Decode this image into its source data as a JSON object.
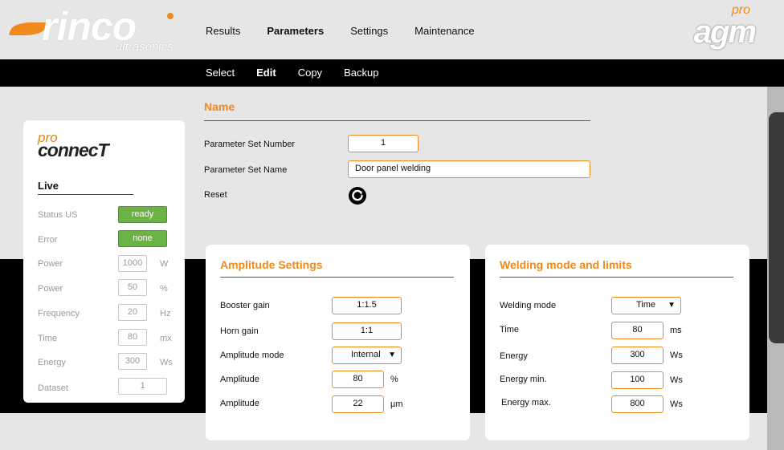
{
  "header": {
    "brand_left": "rinco",
    "brand_left_sub": "ultrasonics",
    "brand_right": "agm",
    "brand_right_pro": "pro",
    "nav": [
      {
        "label": "Results"
      },
      {
        "label": "Parameters"
      },
      {
        "label": "Settings"
      },
      {
        "label": "Maintenance"
      }
    ],
    "active_nav": "Parameters"
  },
  "subnav": {
    "items": [
      {
        "label": "Select"
      },
      {
        "label": "Edit"
      },
      {
        "label": "Copy"
      },
      {
        "label": "Backup"
      }
    ],
    "active": "Edit"
  },
  "name_section": {
    "title": "Name",
    "param_set_number_label": "Parameter Set Number",
    "param_set_number_value": "1",
    "param_set_name_label": "Parameter Set Name",
    "param_set_name_value": "Door panel welding",
    "reset_label": "Reset",
    "reset_icon": "reset-icon"
  },
  "live": {
    "brand_pro": "pro",
    "brand": "connecT",
    "title": "Live",
    "rows": [
      {
        "label": "Status US",
        "value": "ready",
        "unit": ""
      },
      {
        "label": "Error",
        "value": "none",
        "unit": ""
      },
      {
        "label": "Power",
        "value": "1000",
        "unit": "W"
      },
      {
        "label": "Power",
        "value": "50",
        "unit": "%"
      },
      {
        "label": "Frequency",
        "value": "20",
        "unit": "Hz"
      },
      {
        "label": "Time",
        "value": "80",
        "unit": "mx"
      },
      {
        "label": "Energy",
        "value": "300",
        "unit": "Ws"
      },
      {
        "label": "Dataset",
        "value": "1",
        "unit": ""
      }
    ]
  },
  "amplitude": {
    "title": "Amplitude Settings",
    "rows": [
      {
        "label": "Booster gain",
        "value": "1:1.5",
        "unit": ""
      },
      {
        "label": "Horn gain",
        "value": "1:1",
        "unit": ""
      },
      {
        "label": "Amplitude mode",
        "value": "Internal",
        "unit": ""
      },
      {
        "label": "Amplitude",
        "value": "80",
        "unit": "%"
      },
      {
        "label": "Amplitude",
        "value": "22",
        "unit": "µm"
      }
    ]
  },
  "welding": {
    "title": "Welding mode and limits",
    "rows": [
      {
        "label": "Welding mode",
        "value": "Time",
        "unit": ""
      },
      {
        "label": "Time",
        "value": "80",
        "unit": "ms"
      },
      {
        "label": "Energy",
        "value": "300",
        "unit": "Ws"
      },
      {
        "label": "Energy min.",
        "value": "100",
        "unit": "Ws"
      },
      {
        "label": "Energy max.",
        "value": "800",
        "unit": "Ws"
      }
    ]
  },
  "colors": {
    "accent": "#f08a1c",
    "status_green": "#6ab344",
    "nav_bar": "#000000",
    "background": "#e6e6e6"
  }
}
